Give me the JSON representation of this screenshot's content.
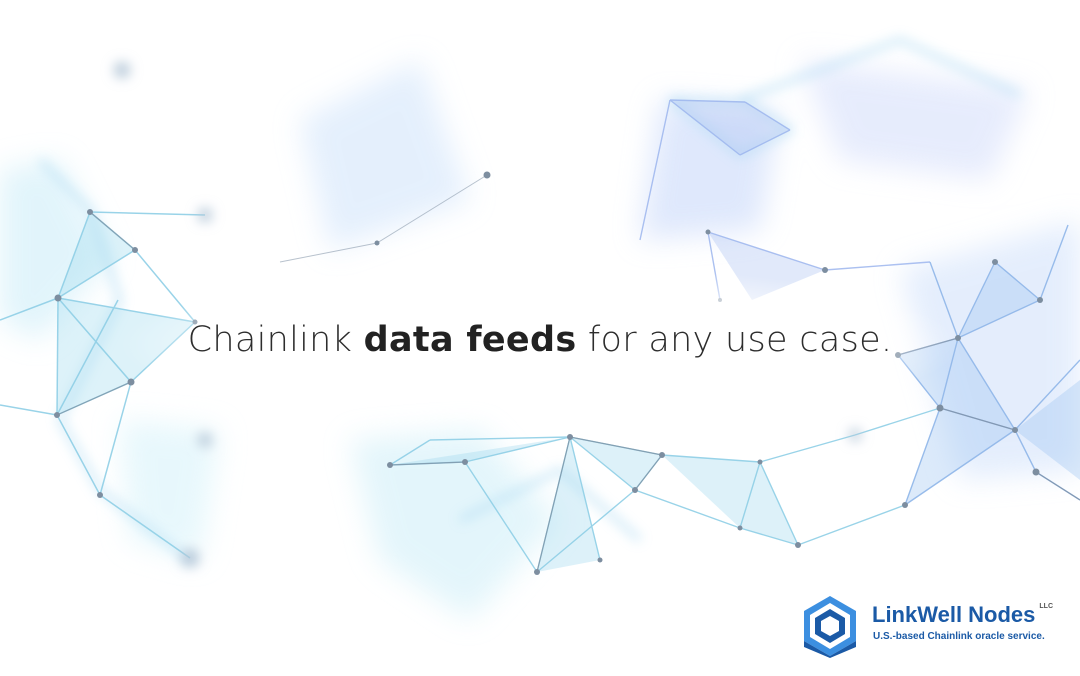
{
  "headline": {
    "prefix": "Chainlink ",
    "emphasis": "data feeds",
    "suffix": " for any use case."
  },
  "logo": {
    "name": "LinkWell Nodes",
    "suffix": "LLC",
    "tagline": "U.S.-based Chainlink oracle service."
  },
  "colors": {
    "brand": "#1b5aa6",
    "network_light": "#9fd9ef",
    "network_blue": "#8fb2ee",
    "node": "#7d8ea0",
    "text": "#2d2d2d"
  }
}
